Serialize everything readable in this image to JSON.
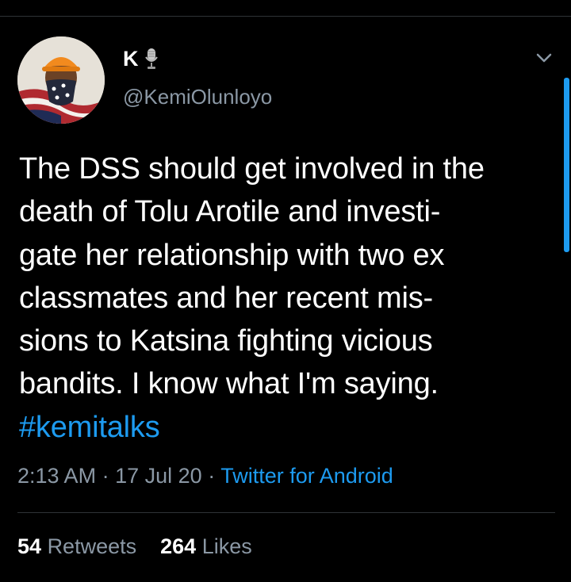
{
  "tweet": {
    "display_name": "K",
    "handle": "@KemiOlunloyo",
    "text_lines": [
      "The DSS should get involved in the",
      "death of Tolu Arotile and investi-",
      "gate her relationship with two ex",
      "classmates and her recent mis-",
      "sions to Katsina fighting vicious",
      "bandits. I know what I'm saying."
    ],
    "hashtag": "#kemitalks",
    "time": "2:13 AM",
    "date": "17 Jul 20",
    "separator": "·",
    "source": "Twitter for Android",
    "retweets_count": "54",
    "retweets_label": "Retweets",
    "likes_count": "264",
    "likes_label": "Likes"
  },
  "icons": {
    "verified_like_icon": "microphone-icon",
    "menu_icon": "chevron-down-icon"
  },
  "colors": {
    "background": "#000000",
    "text": "#ffffff",
    "muted": "#8b98a5",
    "accent": "#1d9bf0",
    "divider": "#2f3336"
  }
}
